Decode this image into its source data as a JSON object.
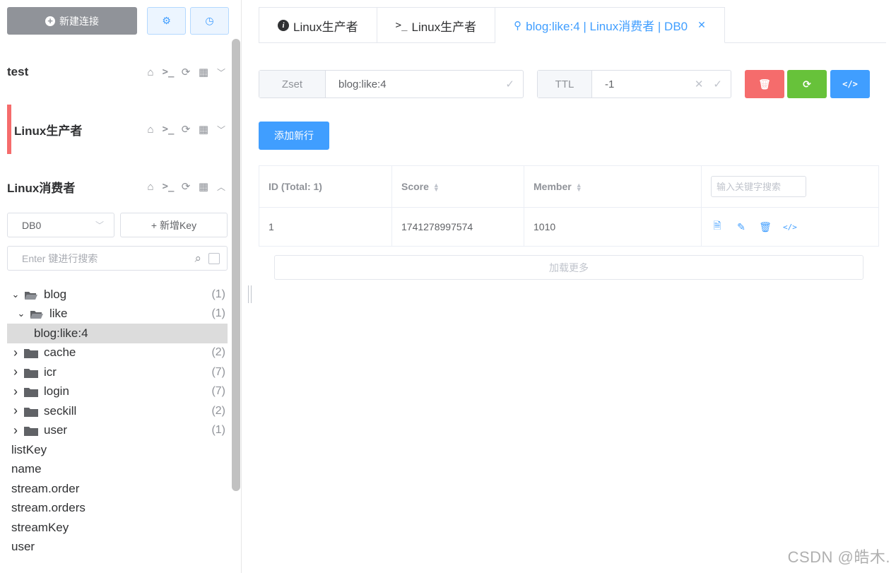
{
  "sidebar": {
    "new_connection_label": "新建连接",
    "connections": [
      {
        "name": "test"
      },
      {
        "name": "Linux生产者"
      },
      {
        "name": "Linux消费者"
      }
    ],
    "db_select_value": "DB0",
    "add_key_label": "+ 新增Key",
    "search_placeholder": "Enter 键进行搜索",
    "tree": [
      {
        "label": "blog",
        "count": "(1)",
        "type": "folder",
        "expanded": true,
        "depth": 0
      },
      {
        "label": "like",
        "count": "(1)",
        "type": "folder",
        "expanded": true,
        "depth": 1
      },
      {
        "label": "blog:like:4",
        "count": "",
        "type": "key",
        "selected": true,
        "depth": 2
      },
      {
        "label": "cache",
        "count": "(2)",
        "type": "folder",
        "expanded": false,
        "depth": 0
      },
      {
        "label": "icr",
        "count": "(7)",
        "type": "folder",
        "expanded": false,
        "depth": 0
      },
      {
        "label": "login",
        "count": "(7)",
        "type": "folder",
        "expanded": false,
        "depth": 0
      },
      {
        "label": "seckill",
        "count": "(2)",
        "type": "folder",
        "expanded": false,
        "depth": 0
      },
      {
        "label": "user",
        "count": "(1)",
        "type": "folder",
        "expanded": false,
        "depth": 0
      },
      {
        "label": "listKey",
        "count": "",
        "type": "key",
        "depth": 0
      },
      {
        "label": "name",
        "count": "",
        "type": "key",
        "depth": 0
      },
      {
        "label": "stream.order",
        "count": "",
        "type": "key",
        "depth": 0
      },
      {
        "label": "stream.orders",
        "count": "",
        "type": "key",
        "depth": 0
      },
      {
        "label": "streamKey",
        "count": "",
        "type": "key",
        "depth": 0
      },
      {
        "label": "user",
        "count": "",
        "type": "key",
        "depth": 0
      }
    ]
  },
  "tabs": [
    {
      "label": "Linux生产者",
      "icon": "info-icon",
      "active": false
    },
    {
      "label": "Linux生产者",
      "icon": "terminal-icon",
      "active": false
    },
    {
      "label": "blog:like:4 | Linux消费者 | DB0",
      "icon": "key-icon",
      "active": true
    }
  ],
  "key_panel": {
    "type_label": "Zset",
    "key_name": "blog:like:4",
    "ttl_label": "TTL",
    "ttl_value": "-1",
    "add_row_label": "添加新行",
    "load_more_label": "加载更多"
  },
  "table": {
    "columns": [
      "ID (Total: 1)",
      "Score",
      "Member"
    ],
    "search_placeholder": "输入关键字搜索",
    "rows": [
      {
        "id": "1",
        "score": "1741278997574",
        "member": "1010"
      }
    ]
  },
  "colors": {
    "primary": "#409eff",
    "danger": "#f56c6c",
    "success": "#67c23a",
    "gray_button": "#909399",
    "active_connection_marker": "#f56c6c"
  },
  "watermark": "CSDN @皓木."
}
